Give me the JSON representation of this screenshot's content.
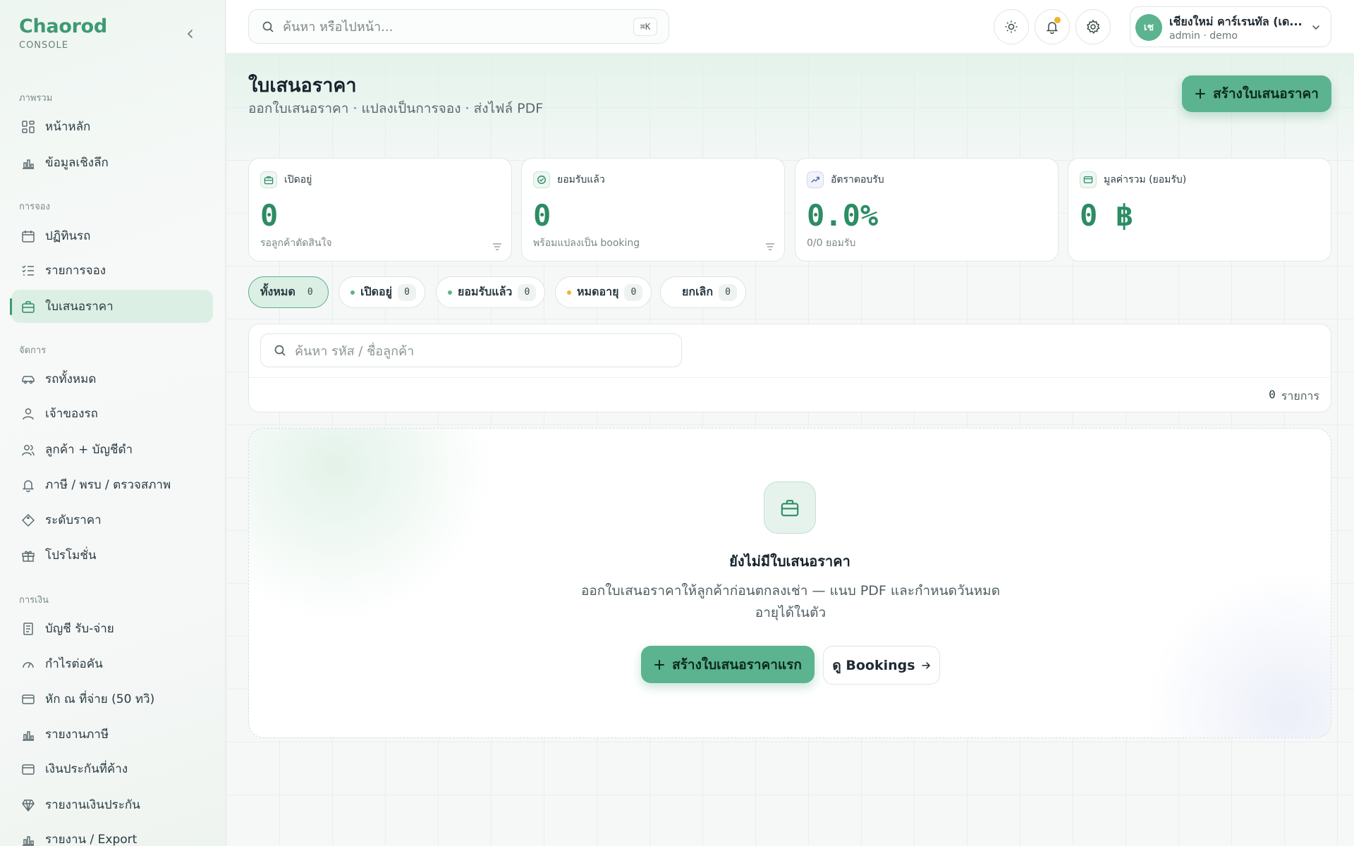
{
  "brand": {
    "name": "Chaorod",
    "sub": "CONSOLE"
  },
  "sidebar": {
    "sections": [
      {
        "title": "ภาพรวม"
      },
      {
        "title": "การจอง"
      },
      {
        "title": "จัดการ"
      },
      {
        "title": "การเงิน"
      }
    ],
    "items": [
      {
        "label": "หน้าหลัก",
        "icon": "dashboard-icon"
      },
      {
        "label": "ข้อมูลเชิงลึก",
        "icon": "bar-chart-icon"
      },
      {
        "label": "ปฏิทินรถ",
        "icon": "calendar-icon"
      },
      {
        "label": "รายการจอง",
        "icon": "list-check-icon"
      },
      {
        "label": "ใบเสนอราคา",
        "icon": "briefcase-icon",
        "active": true
      },
      {
        "label": "รถทั้งหมด",
        "icon": "car-icon"
      },
      {
        "label": "เจ้าของรถ",
        "icon": "user-icon"
      },
      {
        "label": "ลูกค้า + บัญชีดำ",
        "icon": "users-icon"
      },
      {
        "label": "ภาษี / พรบ / ตรวจสภาพ",
        "icon": "bell-icon"
      },
      {
        "label": "ระดับราคา",
        "icon": "tag-icon"
      },
      {
        "label": "โปรโมชั่น",
        "icon": "gift-icon"
      },
      {
        "label": "บัญชี รับ-จ่าย",
        "icon": "receipt-icon"
      },
      {
        "label": "กำไรต่อคัน",
        "icon": "gauge-icon"
      },
      {
        "label": "หัก ณ ที่จ่าย (50 ทวิ)",
        "icon": "card-icon"
      },
      {
        "label": "รายงานภาษี",
        "icon": "bar-chart-icon"
      },
      {
        "label": "เงินประกันที่ค้าง",
        "icon": "wallet-icon"
      },
      {
        "label": "รายงานเงินประกัน",
        "icon": "gem-icon"
      },
      {
        "label": "รายงาน / Export",
        "icon": "bar-chart-icon"
      }
    ]
  },
  "topbar": {
    "search_placeholder": "ค้นหา หรือไปหน้า...",
    "shortcut": "⌘K",
    "user": {
      "initials": "เช",
      "name": "เชียงใหม่ คาร์เรนทัล (เด...",
      "role": "admin · demo"
    }
  },
  "page": {
    "title": "ใบเสนอราคา",
    "subtitle": "ออกใบเสนอราคา · แปลงเป็นการจอง · ส่งไฟล์ PDF",
    "create_button": "สร้างใบเสนอราคา"
  },
  "stats": [
    {
      "label": "เปิดอยู่",
      "value": "0",
      "note": "รอลูกค้าตัดสินใจ"
    },
    {
      "label": "ยอมรับแล้ว",
      "value": "0",
      "note": "พร้อมแปลงเป็น booking"
    },
    {
      "label": "อัตราตอบรับ",
      "value": "0.0%",
      "note": "0/0 ยอมรับ"
    },
    {
      "label": "มูลค่ารวม (ยอมรับ)",
      "value": "0 ฿",
      "note": ""
    }
  ],
  "filters": [
    {
      "label": "ทั้งหมด",
      "count": "0",
      "active": true
    },
    {
      "label": "เปิดอยู่",
      "count": "0",
      "dot": "#5bb38f"
    },
    {
      "label": "ยอมรับแล้ว",
      "count": "0",
      "dot": "#5bb38f"
    },
    {
      "label": "หมดอายุ",
      "count": "0",
      "dot": "#f0b429"
    },
    {
      "label": "ยกเลิก",
      "count": "0"
    }
  ],
  "list": {
    "search_placeholder": "ค้นหา รหัส / ชื่อลูกค้า",
    "count": "0",
    "count_unit": "รายการ"
  },
  "empty": {
    "title": "ยังไม่มีใบเสนอราคา",
    "description": "ออกใบเสนอราคาให้ลูกค้าก่อนตกลงเช่า — แนบ PDF และกำหนดวันหมดอายุได้ในตัว",
    "primary_button": "สร้างใบเสนอราคาแรก",
    "secondary_button": "ดู Bookings"
  },
  "colors": {
    "accent": "#5bb38f",
    "accent_dark": "#2c8c64",
    "warning": "#f0b429"
  }
}
